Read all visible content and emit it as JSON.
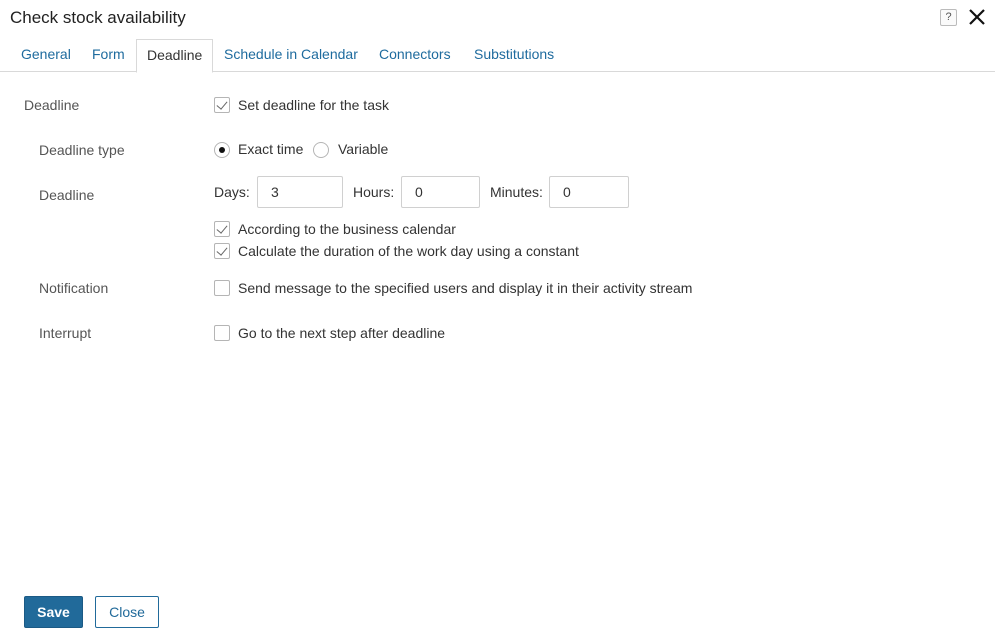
{
  "dialog": {
    "title": "Check stock availability"
  },
  "tabs": [
    {
      "label": "General"
    },
    {
      "label": "Form"
    },
    {
      "label": "Deadline"
    },
    {
      "label": "Schedule in Calendar"
    },
    {
      "label": "Connectors"
    },
    {
      "label": "Substitutions"
    }
  ],
  "active_tab": "Deadline",
  "form": {
    "deadline_section_label": "Deadline",
    "set_deadline": {
      "label": "Set deadline for the task",
      "checked": true
    },
    "deadline_type": {
      "label": "Deadline type",
      "options": [
        {
          "label": "Exact time",
          "selected": true
        },
        {
          "label": "Variable",
          "selected": false
        }
      ]
    },
    "deadline": {
      "label": "Deadline",
      "days_label": "Days:",
      "days_value": "3",
      "hours_label": "Hours:",
      "hours_value": "0",
      "minutes_label": "Minutes:",
      "minutes_value": "0"
    },
    "business_calendar": {
      "label": "According to the business calendar",
      "checked": true
    },
    "work_day_constant": {
      "label": "Calculate the duration of the work day using a constant",
      "checked": true
    },
    "notification": {
      "label": "Notification",
      "option": {
        "label": "Send message to the specified users and display it in their activity stream",
        "checked": false
      }
    },
    "interrupt": {
      "label": "Interrupt",
      "option": {
        "label": "Go to the next step after deadline",
        "checked": false
      }
    }
  },
  "footer": {
    "save_label": "Save",
    "close_label": "Close"
  },
  "colors": {
    "accent": "#216a9a",
    "tab_link": "#1e6b9e"
  },
  "icons": {
    "help": "help-icon",
    "close": "close-icon"
  }
}
